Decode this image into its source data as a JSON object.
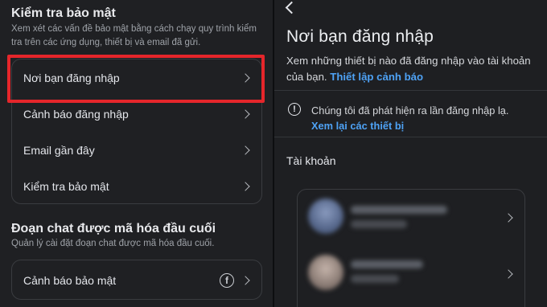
{
  "left": {
    "security_check": {
      "title": "Kiểm tra bảo mật",
      "description": "Xem xét các vấn đề bảo mật bằng cách chạy quy trình kiểm tra trên các ứng dụng, thiết bị và email đã gửi.",
      "items": [
        {
          "label": "Nơi bạn đăng nhập"
        },
        {
          "label": "Cảnh báo đăng nhập"
        },
        {
          "label": "Email gần đây"
        },
        {
          "label": "Kiểm tra bảo mật"
        }
      ]
    },
    "encrypted_chat": {
      "title": "Đoạn chat được mã hóa đầu cuối",
      "description": "Quản lý cài đặt đoạn chat được mã hóa đầu cuối.",
      "items": [
        {
          "label": "Cảnh báo bảo mật",
          "icon": "facebook-icon"
        }
      ]
    }
  },
  "right": {
    "title": "Nơi bạn đăng nhập",
    "description": "Xem những thiết bị nào đã đăng nhập vào tài khoản của bạn.",
    "description_link": "Thiết lập cảnh báo",
    "alert_text": "Chúng tôi đã phát hiện ra lần đăng nhập lạ.",
    "alert_link": "Xem lại các thiết bị",
    "accounts_label": "Tài khoản",
    "accounts": [
      {
        "avatar_color": "#6b7a9a"
      },
      {
        "avatar_color": "#9a8d86"
      }
    ]
  },
  "colors": {
    "background": "#1f2023",
    "link": "#4ea2f5",
    "highlight": "#e5262b"
  }
}
